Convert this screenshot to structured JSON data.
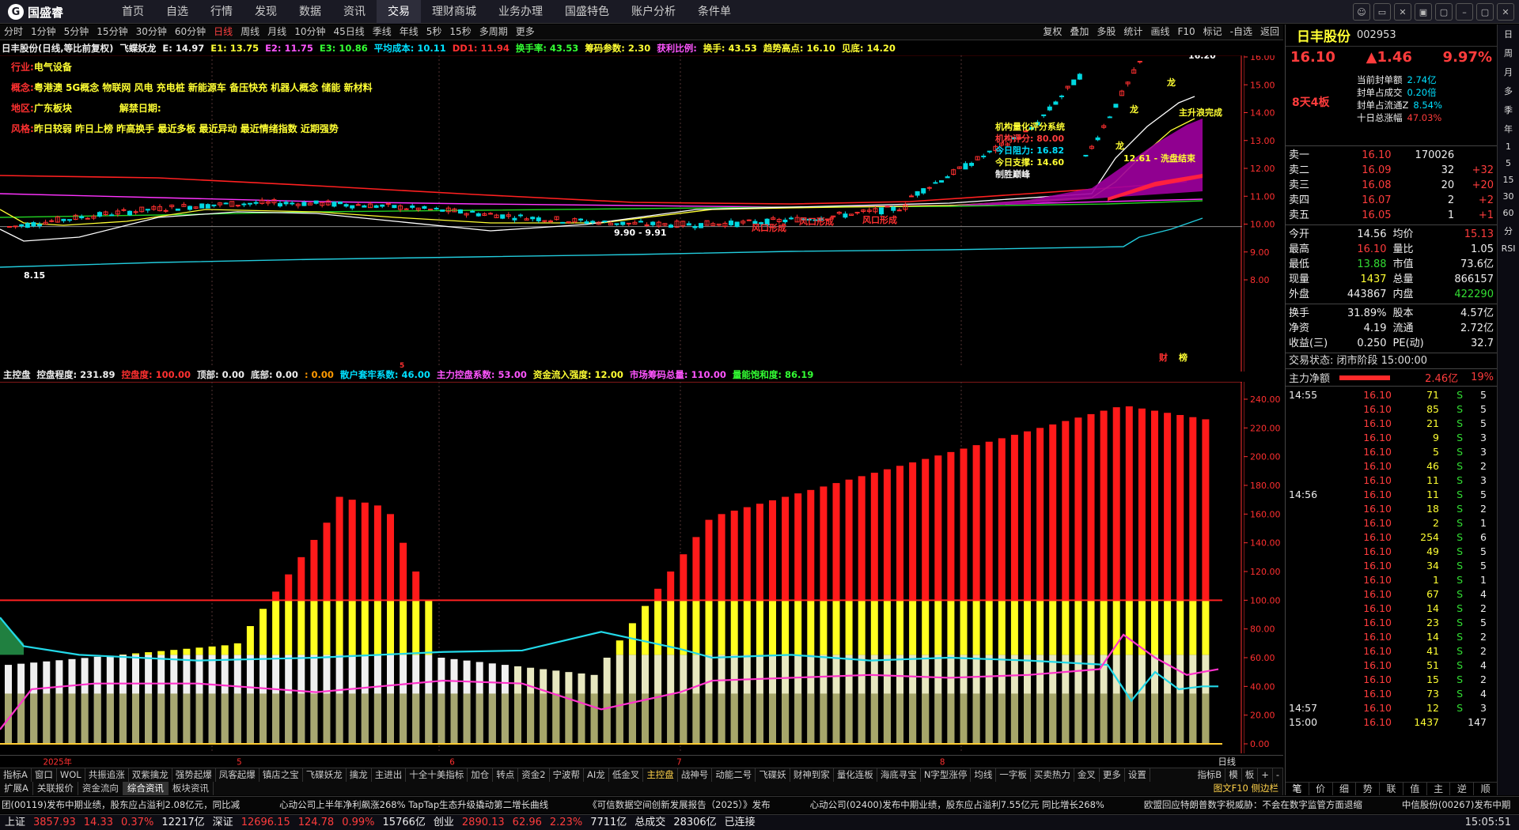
{
  "menu": {
    "logo": "国盛睿",
    "items": [
      "首页",
      "自选",
      "行情",
      "发现",
      "数据",
      "资讯",
      "交易",
      "理财商城",
      "业务办理",
      "国盛特色",
      "账户分析",
      "条件单"
    ],
    "active": 6
  },
  "winbtns": [
    "☺",
    "▭",
    "✕",
    "▣",
    "▢",
    "–",
    "▢",
    "✕"
  ],
  "periods": [
    "分时",
    "1分钟",
    "5分钟",
    "15分钟",
    "30分钟",
    "60分钟",
    "日线",
    "周线",
    "月线",
    "10分钟",
    "45日线",
    "季线",
    "年线",
    "5秒",
    "15秒",
    "多周期",
    "更多"
  ],
  "period_active": 6,
  "tools": [
    "复权",
    "叠加",
    "多股",
    "统计",
    "画线",
    "F10",
    "标记",
    "-自选",
    "返回"
  ],
  "legend1": [
    {
      "t": "日丰股份(日线,等比前复权)",
      "c": "#eee"
    },
    {
      "t": "飞蝶妖龙",
      "c": "#eee"
    },
    {
      "t": "E: 14.97",
      "c": "#eee"
    },
    {
      "t": "E1: 13.75",
      "c": "#ffff33"
    },
    {
      "t": "E2: 11.75",
      "c": "#ff55ff"
    },
    {
      "t": "E3: 10.86",
      "c": "#33ff33"
    },
    {
      "t": "平均成本: 10.11",
      "c": "#00e0ff"
    },
    {
      "t": "DD1: 11.94",
      "c": "#ff3030"
    },
    {
      "t": "换手率: 43.53",
      "c": "#33ff33"
    },
    {
      "t": "筹码参数: 2.30",
      "c": "#ffff33"
    },
    {
      "t": "获利比例:",
      "c": "#ff55ff"
    },
    {
      "t": "换手: 43.53",
      "c": "#ffff33"
    },
    {
      "t": "趋势高点: 16.10",
      "c": "#ffff33"
    },
    {
      "t": "见底: 14.20",
      "c": "#ffff33"
    }
  ],
  "info": {
    "industry_l": "行业:",
    "industry": "电气设备",
    "concept_l": "概念:",
    "concept": "粤港澳 5G概念 物联网 风电 充电桩 新能源车 备压快充 机器人概念 储能 新材料",
    "region_l": "地区:",
    "region": "广东板块",
    "unlock_l": "解禁日期:",
    "style_l": "风格:",
    "style": "昨日较弱 昨日上榜 昨高换手 最近多板 最近异动 最近情绪指数 近期强势"
  },
  "org": {
    "title": "机构量化评分系统",
    "score_l": "机构评分:",
    "score": "80.00",
    "res_l": "今日阻力:",
    "res": "16.82",
    "sup_l": "今日支撑:",
    "sup": "14.60",
    "tag": "制胜巅峰"
  },
  "annot": {
    "high": "16.20",
    "low": "8.15",
    "low2": "9.90 - 9.91",
    "wash": "12.61 - 洗盘结束",
    "main": "主升浪完成",
    "dragon": "龙",
    "wind": "风口形成",
    "caiz": "财",
    "bang": "榜",
    "five": "5"
  },
  "axis1": [
    "16.00",
    "15.00",
    "14.00",
    "13.00",
    "12.00",
    "11.00",
    "10.00",
    "9.00",
    "8.00"
  ],
  "legend2": [
    {
      "t": "主控盘",
      "c": "#eee"
    },
    {
      "t": "控盘程度: 231.89",
      "c": "#eee"
    },
    {
      "t": "控盘度: 100.00",
      "c": "#ff3030"
    },
    {
      "t": "顶部: 0.00",
      "c": "#eee"
    },
    {
      "t": "底部: 0.00",
      "c": "#eee"
    },
    {
      "t": ": 0.00",
      "c": "#ff9900"
    },
    {
      "t": "散户套牢系数: 46.00",
      "c": "#00e0ff"
    },
    {
      "t": "主力控盘系数: 53.00",
      "c": "#ff55ff"
    },
    {
      "t": "资金流入强度: 12.00",
      "c": "#ffff33"
    },
    {
      "t": "市场筹码总量: 110.00",
      "c": "#ff55ff"
    },
    {
      "t": "量能饱和度: 86.19",
      "c": "#33ff33"
    }
  ],
  "axis2": [
    "240.00",
    "220.00",
    "200.00",
    "180.00",
    "160.00",
    "140.00",
    "120.00",
    "100.00",
    "80.00",
    "60.00",
    "40.00",
    "20.00",
    "0.00"
  ],
  "xlabels": [
    "2025年",
    "5",
    "6",
    "7",
    "8"
  ],
  "x_right": "日线",
  "tabs1": [
    "指标A",
    "窗口",
    "WOL",
    "共振追涨",
    "双紫擒龙",
    "强势起爆",
    "凤客起爆",
    "镇店之宝",
    "飞碟妖龙",
    "擒龙",
    "主进出",
    "十全十美指标",
    "加仓",
    "转点",
    "资金2",
    "宁波帮",
    "AI龙",
    "低金叉",
    "主控盘",
    "战神号",
    "动能二号",
    "飞碟妖",
    "财神到家",
    "量化连板",
    "海底寻宝",
    "N字型涨停",
    "均线",
    "一字板",
    "买卖热力",
    "金叉",
    "更多",
    "设置"
  ],
  "tabs1_active": 18,
  "tabs1_r": [
    "指标B",
    "模",
    "板",
    "+",
    "-"
  ],
  "tabs2": [
    "扩展A",
    "关联报价",
    "资金流向",
    "综合资讯",
    "板块资讯"
  ],
  "tabs2_active": 3,
  "tabs2_r": "图文F10 侧边栏",
  "news": [
    "团(00119)发布中期业绩，股东应占溢利2.08亿元，同比减",
    "心动公司上半年净利飙涨268% TapTap生态升级撬动第二增长曲线",
    "《可信数据空间创新发展报告（2025）》发布",
    "心动公司(02400)发布中期业绩，股东应占溢利7.55亿元 同比增长268%",
    "欧盟回应特朗普数字税威胁：不会在数字监管方面退缩",
    "中信股份(00267)发布中期"
  ],
  "status": {
    "sh_l": "上证",
    "sh": "3857.93",
    "sh_c": "14.33",
    "sh_p": "0.37%",
    "sh_v": "12217亿",
    "sz_l": "深证",
    "sz": "12696.15",
    "sz_c": "124.78",
    "sz_p": "0.99%",
    "sz_v": "15766亿",
    "cy_l": "创业",
    "cy": "2890.13",
    "cy_c": "62.96",
    "cy_p": "2.23%",
    "cy_v": "7711亿",
    "total_l": "总成交",
    "total": "28306亿",
    "conn": "已连接",
    "time": "15:05:51"
  },
  "quote": {
    "name": "日丰股份",
    "code": "002953",
    "price": "16.10",
    "change": "▲1.46",
    "pct": "9.97%",
    "board": "8天4板",
    "seal": [
      [
        "当前封单额",
        "2.74亿"
      ],
      [
        "封单占成交",
        "0.20倍"
      ],
      [
        "封单占流通Z",
        "8.54%"
      ],
      [
        "十日总涨幅",
        "47.03%"
      ]
    ],
    "sell": [
      [
        "卖五",
        "16.05",
        "1",
        "+1"
      ],
      [
        "卖四",
        "16.07",
        "2",
        "+2"
      ],
      [
        "卖三",
        "16.08",
        "20",
        "+20"
      ],
      [
        "卖二",
        "16.09",
        "32",
        "+32"
      ],
      [
        "卖一",
        "16.10",
        "170026",
        ""
      ]
    ],
    "stats": [
      [
        "今开",
        "14.56",
        "均价",
        "15.13"
      ],
      [
        "最高",
        "16.10",
        "量比",
        "1.05"
      ],
      [
        "最低",
        "13.88",
        "市值",
        "73.6亿"
      ],
      [
        "现量",
        "1437",
        "总量",
        "866157"
      ],
      [
        "外盘",
        "443867",
        "内盘",
        "422290"
      ]
    ],
    "stats2": [
      [
        "换手",
        "31.89%",
        "股本",
        "4.57亿"
      ],
      [
        "净资",
        "4.19",
        "流通",
        "2.72亿"
      ],
      [
        "收益(三)",
        "0.250",
        "PE(动)",
        "32.7"
      ]
    ],
    "state": "交易状态: 闭市阶段 15:00:00",
    "net_l": "主力净额",
    "net": "2.46亿",
    "net_p": "19%"
  },
  "trades": [
    [
      "14:55",
      "16.10",
      "71",
      "S",
      "5"
    ],
    [
      "",
      "16.10",
      "85",
      "S",
      "5"
    ],
    [
      "",
      "16.10",
      "21",
      "S",
      "5"
    ],
    [
      "",
      "16.10",
      "9",
      "S",
      "3"
    ],
    [
      "",
      "16.10",
      "5",
      "S",
      "3"
    ],
    [
      "",
      "16.10",
      "46",
      "S",
      "2"
    ],
    [
      "",
      "16.10",
      "11",
      "S",
      "3"
    ],
    [
      "14:56",
      "16.10",
      "11",
      "S",
      "5"
    ],
    [
      "",
      "16.10",
      "18",
      "S",
      "2"
    ],
    [
      "",
      "16.10",
      "2",
      "S",
      "1"
    ],
    [
      "",
      "16.10",
      "254",
      "S",
      "6"
    ],
    [
      "",
      "16.10",
      "49",
      "S",
      "5"
    ],
    [
      "",
      "16.10",
      "34",
      "S",
      "5"
    ],
    [
      "",
      "16.10",
      "1",
      "S",
      "1"
    ],
    [
      "",
      "16.10",
      "67",
      "S",
      "4"
    ],
    [
      "",
      "16.10",
      "14",
      "S",
      "2"
    ],
    [
      "",
      "16.10",
      "23",
      "S",
      "5"
    ],
    [
      "",
      "16.10",
      "14",
      "S",
      "2"
    ],
    [
      "",
      "16.10",
      "41",
      "S",
      "2"
    ],
    [
      "",
      "16.10",
      "51",
      "S",
      "4"
    ],
    [
      "",
      "16.10",
      "15",
      "S",
      "2"
    ],
    [
      "",
      "16.10",
      "73",
      "S",
      "4"
    ],
    [
      "14:57",
      "16.10",
      "12",
      "S",
      "3"
    ],
    [
      "15:00",
      "16.10",
      "1437",
      "",
      "147"
    ]
  ],
  "rtabs": [
    "笔",
    "价",
    "细",
    "势",
    "联",
    "值",
    "主",
    "逆",
    "顺"
  ],
  "side": [
    "日",
    "周",
    "月",
    "多",
    "季",
    "年",
    "1",
    "5",
    "15",
    "30",
    "60",
    "分",
    "RSI"
  ]
}
